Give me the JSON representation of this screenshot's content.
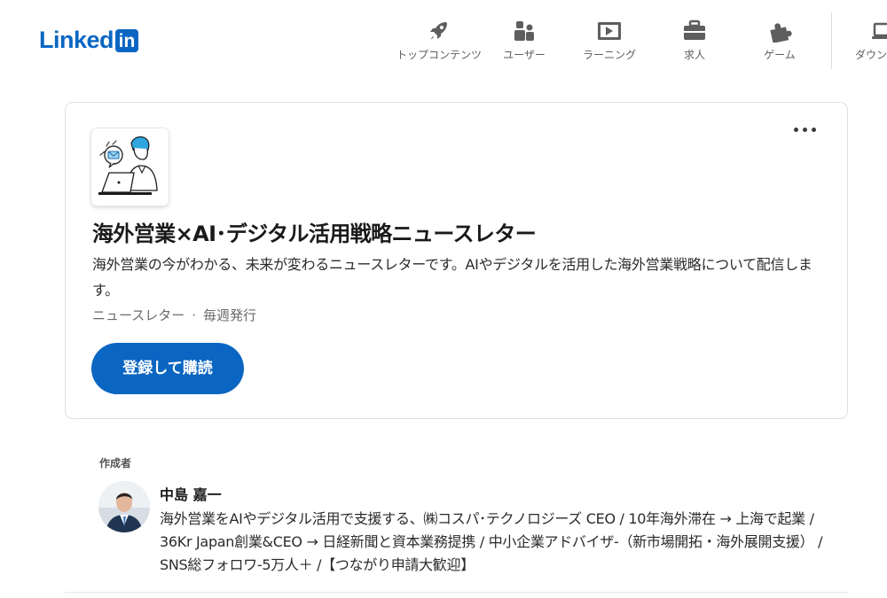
{
  "brand": {
    "logo_text": "Linked",
    "logo_box_text": "in",
    "color": "#0a66c2"
  },
  "nav": {
    "items": [
      {
        "label": "トップコンテンツ",
        "icon": "rocket-icon"
      },
      {
        "label": "ユーザー",
        "icon": "people-icon"
      },
      {
        "label": "ラーニング",
        "icon": "video-icon"
      },
      {
        "label": "求人",
        "icon": "briefcase-icon"
      },
      {
        "label": "ゲーム",
        "icon": "puzzle-icon"
      },
      {
        "label": "ダウンロード",
        "icon": "laptop-icon"
      }
    ]
  },
  "newsletter": {
    "title": "海外営業×AI･デジタル活用戦略ニュースレター",
    "description": "海外営業の今がわかる、未来が変わるニュースレターです。AIやデジタルを活用した海外営業戦略について配信します。",
    "type_label": "ニュースレター",
    "separator": "·",
    "frequency": "毎週発行",
    "subscribe_label": "登録して購読",
    "more_icon": "more-options-icon"
  },
  "author": {
    "heading": "作成者",
    "name": "中島 嘉一",
    "bio": "海外営業をAIやデジタル活用で支援する、㈱コスパ･テクノロジーズ CEO / 10年海外滞在 → 上海で起業 / 36Kr Japan創業&CEO → 日経新聞と資本業務提携 / 中小企業アドバイザ-（新市場開拓・海外展開支援） / SNS総フォロワ-5万人＋ /【つながり申請大歓迎】"
  }
}
